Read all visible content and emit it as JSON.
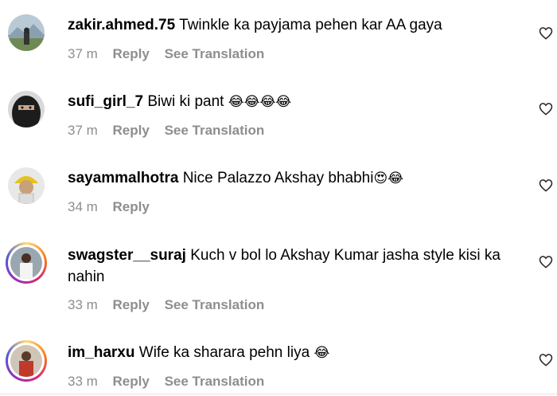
{
  "comments": [
    {
      "username": "zakir.ahmed.75",
      "text": "Twinkle ka payjama pehen kar AA gaya",
      "emoji": "",
      "time": "37 m",
      "reply": "Reply",
      "translate": "See Translation"
    },
    {
      "username": "sufi_girl_7",
      "text": "Biwi ki pant",
      "emoji": "😂😂😂😂",
      "time": "37 m",
      "reply": "Reply",
      "translate": "See Translation"
    },
    {
      "username": "sayammalhotra",
      "text": "Nice Palazzo Akshay bhabhi",
      "emoji": "😍😂",
      "time": "34 m",
      "reply": "Reply",
      "translate": ""
    },
    {
      "username": "swagster__suraj",
      "text": "Kuch v bol lo Akshay Kumar jasha style kisi ka nahin",
      "emoji": "",
      "time": "33 m",
      "reply": "Reply",
      "translate": "See Translation"
    },
    {
      "username": "im_harxu",
      "text": "Wife ka sharara pehn liya",
      "emoji": "😂",
      "time": "33 m",
      "reply": "Reply",
      "translate": "See Translation"
    }
  ],
  "colors": {
    "meta": "#8e8e8e",
    "text": "#000000"
  },
  "icons": {
    "like": "heart-outline-icon"
  }
}
